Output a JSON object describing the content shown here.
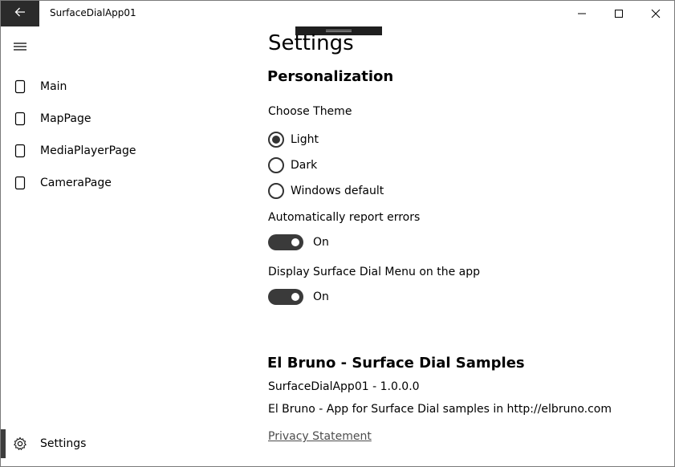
{
  "titlebar": {
    "app_title": "SurfaceDialApp01"
  },
  "nav": {
    "items": [
      {
        "label": "Main",
        "icon": "page-icon"
      },
      {
        "label": "MapPage",
        "icon": "page-icon"
      },
      {
        "label": "MediaPlayerPage",
        "icon": "page-icon"
      },
      {
        "label": "CameraPage",
        "icon": "page-icon"
      }
    ],
    "settings_label": "Settings",
    "settings_icon": "gear-icon"
  },
  "page": {
    "title": "Settings",
    "personalization_header": "Personalization",
    "choose_theme_label": "Choose Theme",
    "theme_options": [
      {
        "label": "Light",
        "selected": true
      },
      {
        "label": "Dark",
        "selected": false
      },
      {
        "label": "Windows default",
        "selected": false
      }
    ],
    "report_errors_label": "Automatically report errors",
    "report_errors_state": "On",
    "dial_menu_label": "Display Surface Dial Menu on the app",
    "dial_menu_state": "On",
    "about_header": "El Bruno - Surface Dial Samples",
    "version_text": "SurfaceDialApp01 - 1.0.0.0",
    "description_text": "El Bruno - App for Surface Dial samples in http://elbruno.com",
    "privacy_link": "Privacy Statement"
  },
  "colors": {
    "back_button_bg": "#2b2b2b",
    "toggle_on": "#3a3a3a",
    "selection_bar": "#3d3d3d"
  }
}
